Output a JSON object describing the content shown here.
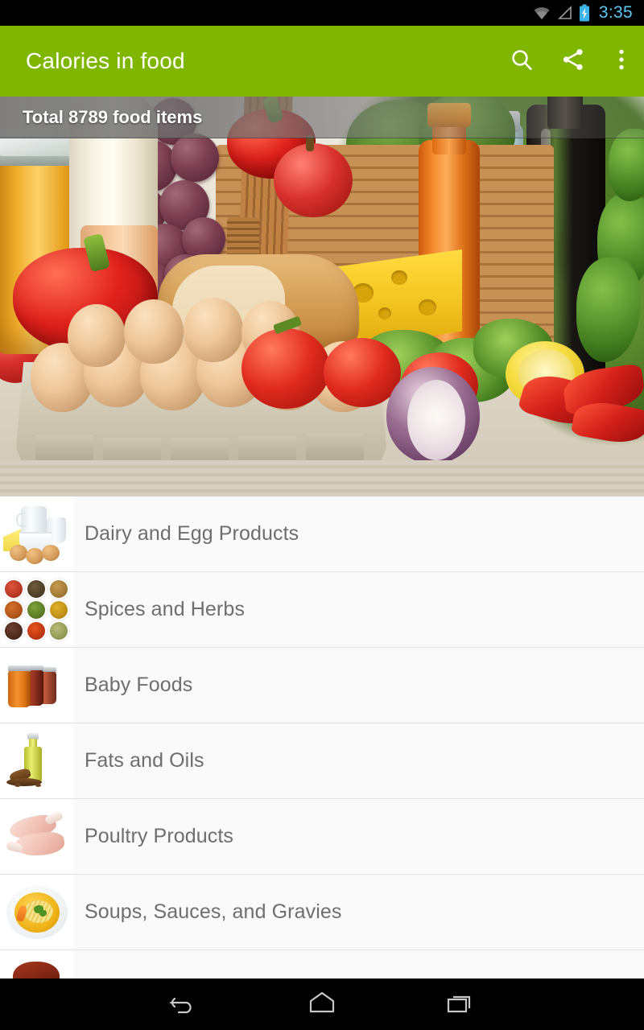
{
  "statusbar": {
    "time": "3:35",
    "icons": [
      "wifi-icon",
      "signal-icon",
      "battery-charging-icon"
    ]
  },
  "actionbar": {
    "title": "Calories in food",
    "background_color": "#80b600",
    "title_color": "#ffffff",
    "actions": [
      {
        "name": "search-icon",
        "label": "Search"
      },
      {
        "name": "share-icon",
        "label": "Share"
      },
      {
        "name": "overflow-menu-icon",
        "label": "More options"
      }
    ]
  },
  "hero": {
    "banner_text": "Total 8789 food items",
    "banner_text_color": "#ffffff",
    "image_alt": "assorted food photo"
  },
  "list": {
    "items": [
      {
        "label": "Dairy and Egg Products",
        "thumb": "dairy-thumb"
      },
      {
        "label": "Spices and Herbs",
        "thumb": "spices-thumb"
      },
      {
        "label": "Baby Foods",
        "thumb": "baby-foods-thumb"
      },
      {
        "label": "Fats and Oils",
        "thumb": "fats-oils-thumb"
      },
      {
        "label": "Poultry Products",
        "thumb": "poultry-thumb"
      },
      {
        "label": "Soups, Sauces, and Gravies",
        "thumb": "soups-thumb"
      },
      {
        "label": "",
        "thumb": "meat-thumb"
      }
    ],
    "text_color": "#6e6e6e",
    "background_color": "#fafafa",
    "divider_color": "#e2e2e2"
  },
  "navbar": {
    "buttons": [
      {
        "name": "nav-back-button",
        "label": "Back"
      },
      {
        "name": "nav-home-button",
        "label": "Home"
      },
      {
        "name": "nav-recents-button",
        "label": "Recent apps"
      }
    ]
  }
}
